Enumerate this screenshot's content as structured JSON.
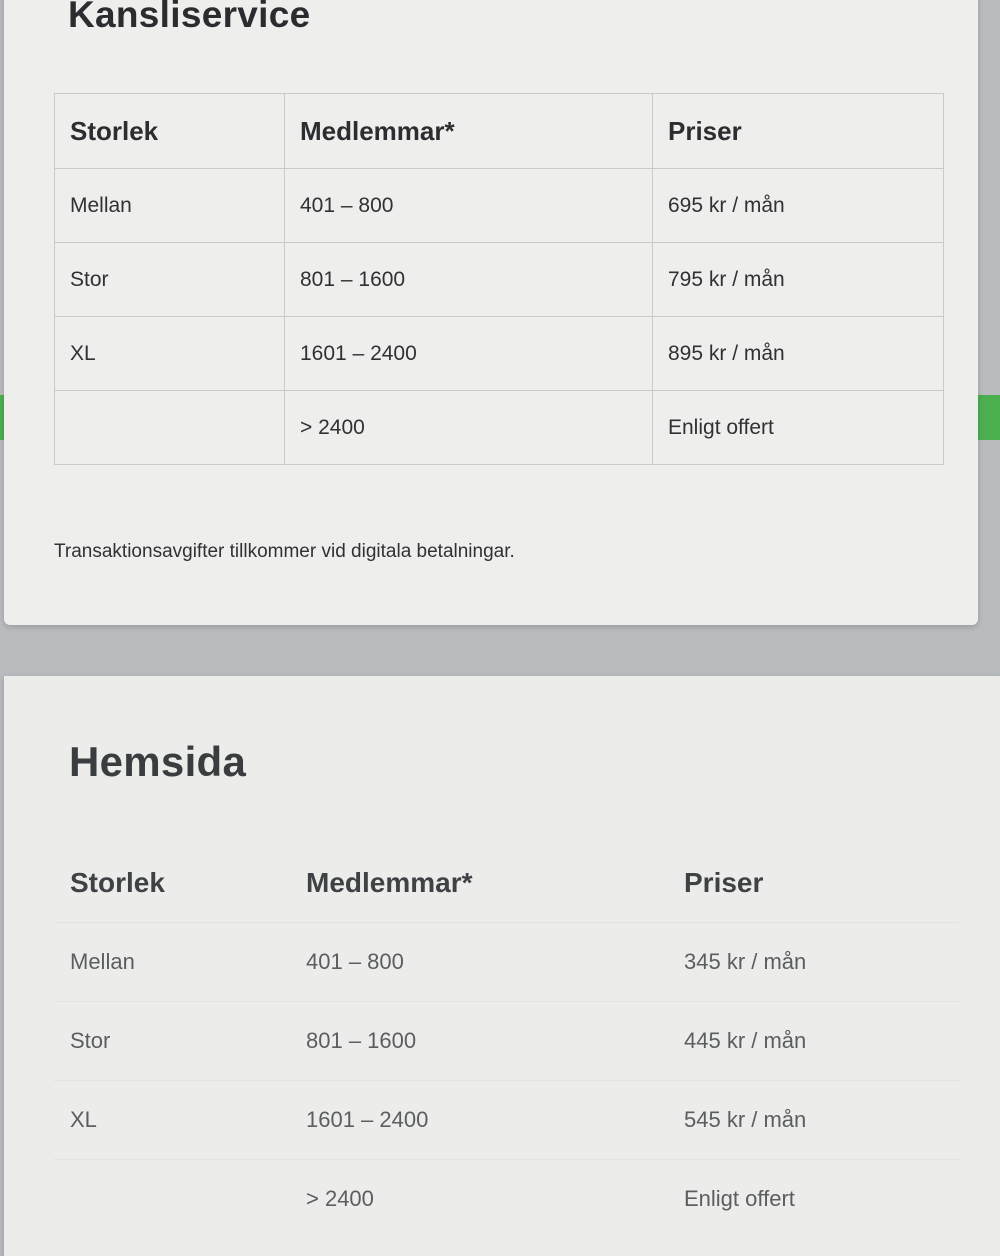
{
  "kansliservice": {
    "title": "Kansliservice",
    "headers": [
      "Storlek",
      "Medlemmar*",
      "Priser"
    ],
    "rows": [
      [
        "Mellan",
        "401 – 800",
        "695 kr / mån"
      ],
      [
        "Stor",
        "801 – 1600",
        "795 kr / mån"
      ],
      [
        "XL",
        "1601 – 2400",
        "895 kr / mån"
      ],
      [
        "",
        "> 2400",
        "Enligt offert"
      ]
    ],
    "note": "Transaktionsavgifter tillkommer vid digitala betalningar."
  },
  "hemsida": {
    "title": "Hemsida",
    "headers": [
      "Storlek",
      "Medlemmar*",
      "Priser"
    ],
    "rows": [
      [
        "Mellan",
        "401 – 800",
        "345 kr / mån"
      ],
      [
        "Stor",
        "801 – 1600",
        "445 kr / mån"
      ],
      [
        "XL",
        "1601 – 2400",
        "545 kr / mån"
      ],
      [
        "",
        "> 2400",
        "Enligt offert"
      ]
    ]
  }
}
